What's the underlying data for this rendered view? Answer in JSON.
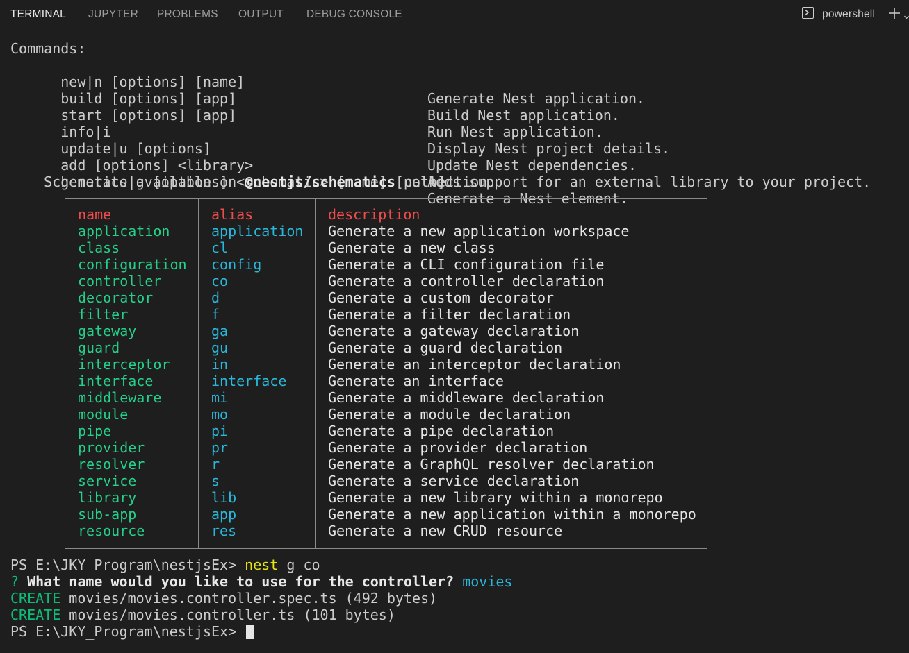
{
  "tabs": [
    {
      "label": "TERMINAL",
      "active": true
    },
    {
      "label": "JUPYTER"
    },
    {
      "label": "PROBLEMS"
    },
    {
      "label": "OUTPUT"
    },
    {
      "label": "DEBUG CONSOLE"
    }
  ],
  "shell": {
    "label": "powershell",
    "icon": "terminal-icon"
  },
  "help": {
    "header": "Commands:",
    "commands": [
      {
        "cmd": "  new|n [options] [name]",
        "desc": "Generate Nest application."
      },
      {
        "cmd": "  build [options] [app]",
        "desc": "Build Nest application."
      },
      {
        "cmd": "  start [options] [app]",
        "desc": "Run Nest application."
      },
      {
        "cmd": "  info|i",
        "desc": "Display Nest project details."
      },
      {
        "cmd": "  update|u [options]",
        "desc": "Update Nest dependencies."
      },
      {
        "cmd": "  add [options] <library>",
        "desc": "Adds support for an external library to your project."
      },
      {
        "cmd": "  generate|g [options] <schematic> [name] [path]",
        "desc": "Generate a Nest element."
      }
    ],
    "schematics_prefix": "    Schematics available on ",
    "schematics_bold": "@nestjs/schematics",
    "schematics_suffix": " collection:"
  },
  "table": {
    "headers": [
      "name",
      "alias",
      "description"
    ],
    "rows": [
      [
        "application",
        "application",
        "Generate a new application workspace"
      ],
      [
        "class",
        "cl",
        "Generate a new class"
      ],
      [
        "configuration",
        "config",
        "Generate a CLI configuration file"
      ],
      [
        "controller",
        "co",
        "Generate a controller declaration"
      ],
      [
        "decorator",
        "d",
        "Generate a custom decorator"
      ],
      [
        "filter",
        "f",
        "Generate a filter declaration"
      ],
      [
        "gateway",
        "ga",
        "Generate a gateway declaration"
      ],
      [
        "guard",
        "gu",
        "Generate a guard declaration"
      ],
      [
        "interceptor",
        "in",
        "Generate an interceptor declaration"
      ],
      [
        "interface",
        "interface",
        "Generate an interface"
      ],
      [
        "middleware",
        "mi",
        "Generate a middleware declaration"
      ],
      [
        "module",
        "mo",
        "Generate a module declaration"
      ],
      [
        "pipe",
        "pi",
        "Generate a pipe declaration"
      ],
      [
        "provider",
        "pr",
        "Generate a provider declaration"
      ],
      [
        "resolver",
        "r",
        "Generate a GraphQL resolver declaration"
      ],
      [
        "service",
        "s",
        "Generate a service declaration"
      ],
      [
        "library",
        "lib",
        "Generate a new library within a monorepo"
      ],
      [
        "sub-app",
        "app",
        "Generate a new application within a monorepo"
      ],
      [
        "resource",
        "res",
        "Generate a new CRUD resource"
      ]
    ]
  },
  "session": {
    "prompt": "PS E:\\JKY_Program\\nestjsEx> ",
    "command": "nest",
    "command_args": " g co",
    "question_mark": "?",
    "question": " What name would you like to use for the controller?",
    "answer": " movies",
    "created": [
      {
        "tag": "CREATE",
        "text": " movies/movies.controller.spec.ts (492 bytes)"
      },
      {
        "tag": "CREATE",
        "text": " movies/movies.controller.ts (101 bytes)"
      }
    ]
  },
  "colors": {
    "background": "#1e1e1e",
    "foreground": "#cccccc",
    "green": "#23d18b",
    "blue": "#29b8db",
    "red": "#f14c4c",
    "yellow": "#e5e510"
  }
}
